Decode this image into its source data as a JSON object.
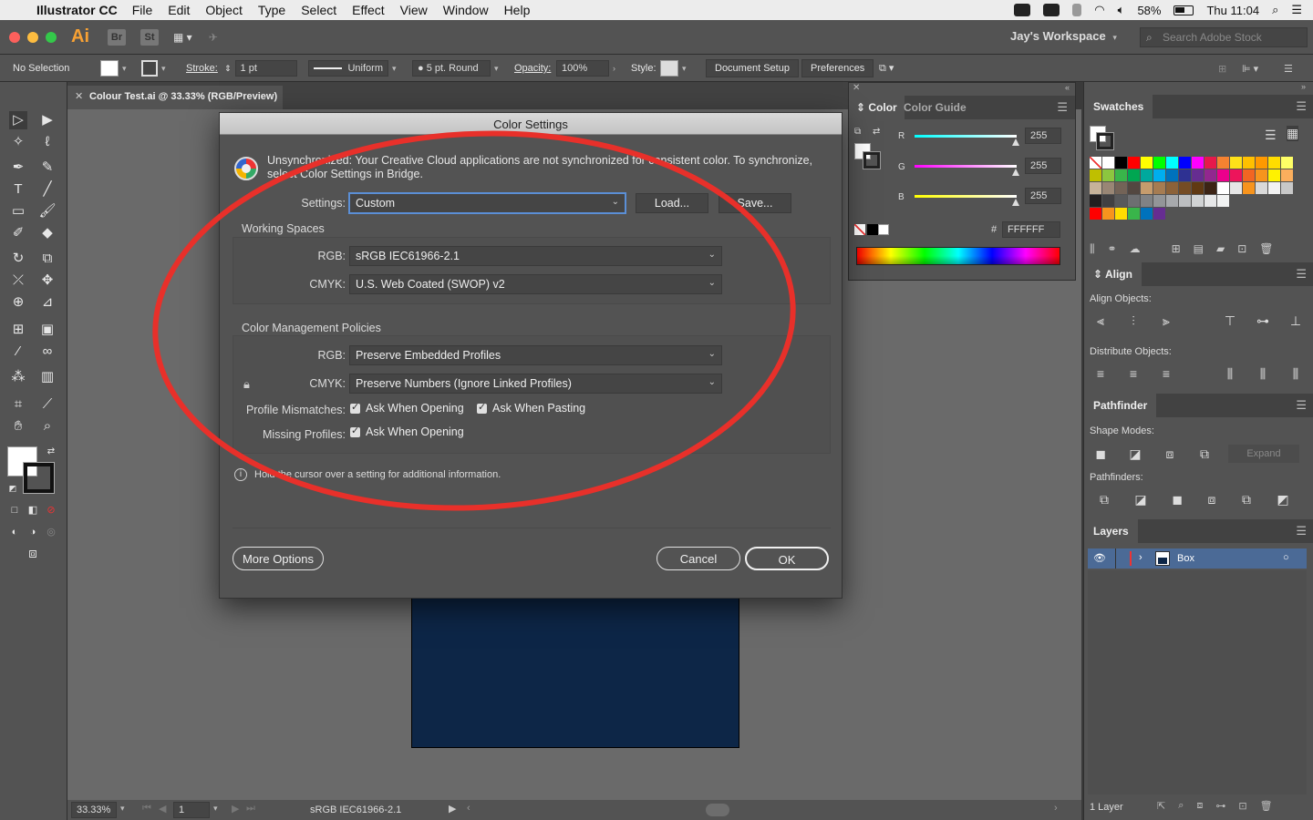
{
  "menubar": {
    "app_name": "Illustrator CC",
    "menus": [
      "File",
      "Edit",
      "Object",
      "Type",
      "Select",
      "Effect",
      "View",
      "Window",
      "Help"
    ],
    "battery": "58%",
    "clock": "Thu 11:04"
  },
  "appbar": {
    "logo": "Ai",
    "bridge": "Br",
    "stock": "St",
    "workspace": "Jay's Workspace",
    "stock_search_placeholder": "Search Adobe Stock"
  },
  "controlbar": {
    "selection": "No Selection",
    "stroke_label": "Stroke:",
    "stroke_weight": "1 pt",
    "profile": "Uniform",
    "brush": "5 pt. Round",
    "opacity_label": "Opacity:",
    "opacity": "100%",
    "style_label": "Style:",
    "document_setup": "Document Setup",
    "preferences": "Preferences"
  },
  "document": {
    "tab_title": "Colour Test.ai @ 33.33% (RGB/Preview)",
    "zoom": "33.33%",
    "artboard_number": "1",
    "status_profile": "sRGB IEC61966-2.1",
    "artboard_color": "#0d2647"
  },
  "color_panel": {
    "tabs": [
      "Color",
      "Color Guide"
    ],
    "channels": [
      {
        "label": "R",
        "value": "255",
        "gradient": "linear-gradient(to right,#00ffff,#ffffff)"
      },
      {
        "label": "G",
        "value": "255",
        "gradient": "linear-gradient(to right,#ff00ff,#ffffff)"
      },
      {
        "label": "B",
        "value": "255",
        "gradient": "linear-gradient(to right,#ffff00,#ffffff)"
      }
    ],
    "hex_label": "#",
    "hex": "FFFFFF"
  },
  "swatches": {
    "title": "Swatches",
    "rows": [
      [
        "#ffffff",
        "#ffffff",
        "#000000",
        "#ff0000",
        "#ffff00",
        "#00ff00",
        "#00ffff",
        "#0000ff",
        "#ff00ff",
        "#e6194b",
        "#f58231",
        "#ffe119",
        "#ffc000",
        "#ff9900",
        "#ffdd00",
        "#ffff66"
      ],
      [
        "#bfbf00",
        "#8cc63f",
        "#39b54a",
        "#00a651",
        "#00a99d",
        "#00aeef",
        "#0072bc",
        "#2e3192",
        "#662d91",
        "#92278f",
        "#ec008c",
        "#ed145b",
        "#f26522",
        "#f7941d",
        "#fff200",
        "#fbaf5d"
      ],
      [
        "#c7b299",
        "#998675",
        "#736357",
        "#534741",
        "#c69c6d",
        "#a67c52",
        "#8c6239",
        "#754c24",
        "#603913",
        "#3c2415",
        "#ffffff",
        "#e6e6e6",
        "#f7941d",
        "#d9d9d9",
        "#f2f2f2",
        "#c8c8c8"
      ],
      [
        "#231f20",
        "#414042",
        "#58595b",
        "#6d6e71",
        "#808285",
        "#939598",
        "#a7a9ac",
        "#bcbec0",
        "#d1d3d4",
        "#e6e7e8",
        "#f1f2f2"
      ],
      [
        "#ff0000",
        "#f7941d",
        "#ffdd00",
        "#39b54a",
        "#0072bc",
        "#662d91"
      ]
    ]
  },
  "align_panel": {
    "title": "Align",
    "align_objects": "Align Objects:",
    "distribute_objects": "Distribute Objects:"
  },
  "pathfinder_panel": {
    "title": "Pathfinder",
    "shape_modes": "Shape Modes:",
    "expand": "Expand",
    "pathfinders": "Pathfinders:"
  },
  "layers_panel": {
    "title": "Layers",
    "layer_name": "Box",
    "layer_count": "1 Layer"
  },
  "dialog": {
    "title": "Color Settings",
    "sync_message": "Unsynchronized: Your Creative Cloud applications are not synchronized for consistent color. To synchronize, select Color Settings in Bridge.",
    "settings_label": "Settings:",
    "settings_value": "Custom",
    "load_button": "Load...",
    "save_button": "Save...",
    "working_spaces": {
      "title": "Working Spaces",
      "rgb_label": "RGB:",
      "rgb_value": "sRGB IEC61966-2.1",
      "cmyk_label": "CMYK:",
      "cmyk_value": "U.S. Web Coated (SWOP) v2"
    },
    "policies": {
      "title": "Color Management Policies",
      "rgb_label": "RGB:",
      "rgb_value": "Preserve Embedded Profiles",
      "cmyk_label": "CMYK:",
      "cmyk_value": "Preserve Numbers (Ignore Linked Profiles)",
      "mismatch_label": "Profile Mismatches:",
      "ask_opening": "Ask When Opening",
      "ask_pasting": "Ask When Pasting",
      "missing_label": "Missing Profiles:",
      "missing_ask_opening": "Ask When Opening"
    },
    "info_text": "Hold the cursor over a setting for additional information.",
    "more_options": "More Options",
    "cancel": "Cancel",
    "ok": "OK"
  },
  "annotation_color": "#e8302a"
}
